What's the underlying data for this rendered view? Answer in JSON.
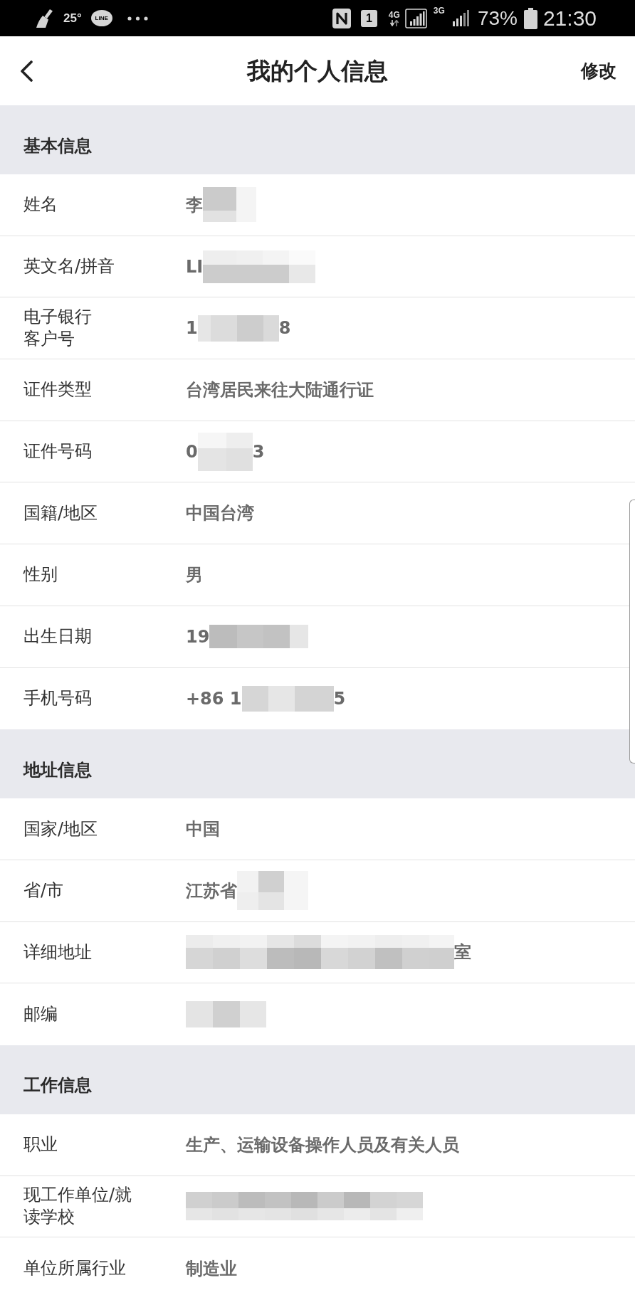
{
  "status_bar": {
    "temperature": "25°",
    "chat_badge": "LINE",
    "sim_slot": "1",
    "network_1": "4G",
    "network_2": "3G",
    "battery": "73%",
    "time": "21:30"
  },
  "header": {
    "title": "我的个人信息",
    "action": "修改"
  },
  "sections": [
    {
      "title": "基本信息",
      "rows": [
        {
          "label": "姓名",
          "value": [
            {
              "kind": "text",
              "text": "李"
            },
            {
              "kind": "redacted"
            }
          ]
        },
        {
          "label": "英文名/拼音",
          "value": [
            {
              "kind": "text",
              "text": "LI"
            },
            {
              "kind": "redacted"
            }
          ]
        },
        {
          "label_lines": [
            "电子银行",
            "客户号"
          ],
          "value": [
            {
              "kind": "text",
              "text": "1"
            },
            {
              "kind": "redacted"
            },
            {
              "kind": "text",
              "text": "8"
            }
          ]
        },
        {
          "label": "证件类型",
          "value": [
            {
              "kind": "text",
              "text": "台湾居民来往大陆通行证"
            }
          ]
        },
        {
          "label": "证件号码",
          "value": [
            {
              "kind": "text",
              "text": "0"
            },
            {
              "kind": "redacted"
            },
            {
              "kind": "text",
              "text": "3"
            }
          ]
        },
        {
          "label": "国籍/地区",
          "value": [
            {
              "kind": "text",
              "text": "中国台湾"
            }
          ]
        },
        {
          "label": "性别",
          "value": [
            {
              "kind": "text",
              "text": "男"
            }
          ]
        },
        {
          "label": "出生日期",
          "value": [
            {
              "kind": "text",
              "text": "19"
            },
            {
              "kind": "redacted"
            }
          ]
        },
        {
          "label": "手机号码",
          "value": [
            {
              "kind": "text",
              "text": "+86 1"
            },
            {
              "kind": "redacted"
            },
            {
              "kind": "text",
              "text": "5"
            }
          ]
        }
      ]
    },
    {
      "title": "地址信息",
      "rows": [
        {
          "label": "国家/地区",
          "value": [
            {
              "kind": "text",
              "text": "中国"
            }
          ]
        },
        {
          "label": "省/市",
          "value": [
            {
              "kind": "text",
              "text": "江苏省"
            },
            {
              "kind": "redacted"
            }
          ]
        },
        {
          "label": "详细地址",
          "value": [
            {
              "kind": "redacted"
            },
            {
              "kind": "text",
              "text": "室"
            }
          ]
        },
        {
          "label": "邮编",
          "value": [
            {
              "kind": "redacted"
            }
          ]
        }
      ]
    },
    {
      "title": "工作信息",
      "rows": [
        {
          "label": "职业",
          "value": [
            {
              "kind": "text",
              "text": "生产、运输设备操作人员及有关人员"
            }
          ]
        },
        {
          "label": "现工作单位/就读学校",
          "value": [
            {
              "kind": "redacted"
            }
          ]
        },
        {
          "label": "单位所属行业",
          "value": [
            {
              "kind": "text",
              "text": "制造业"
            }
          ]
        }
      ]
    }
  ]
}
